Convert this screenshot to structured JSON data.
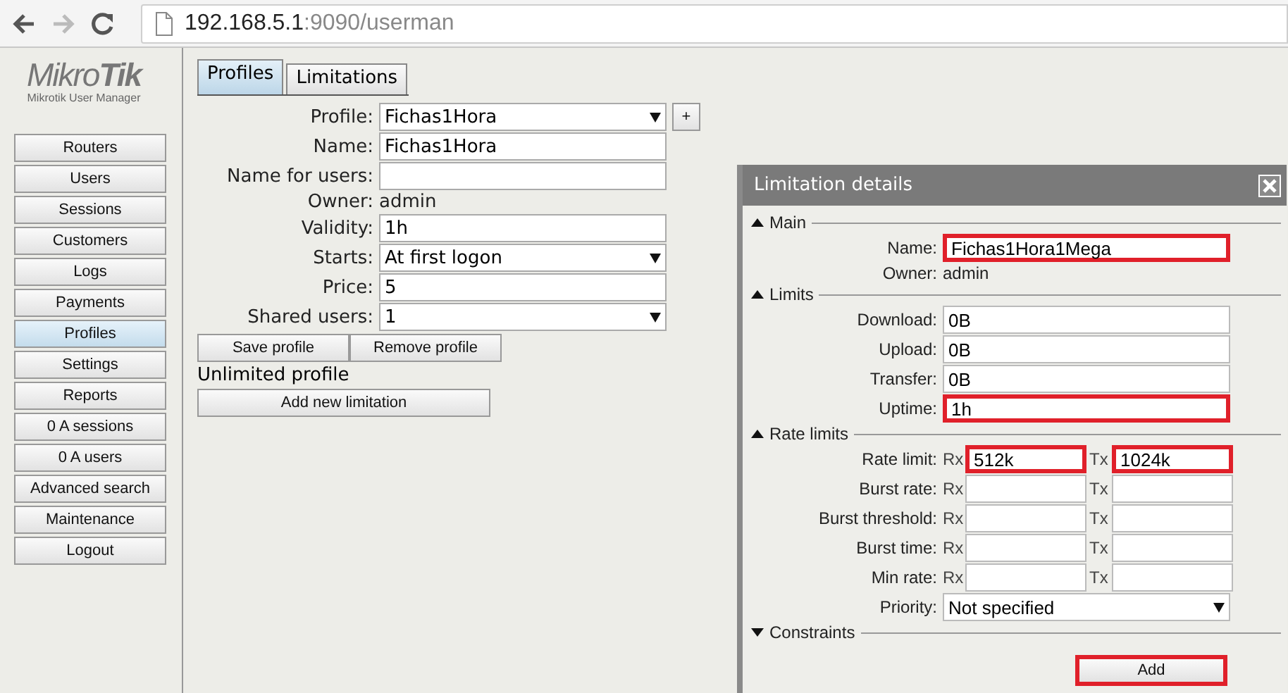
{
  "browser": {
    "url_host": "192.168.5.1",
    "url_rest": ":9090/userman"
  },
  "logo": {
    "brand_light": "Mikro",
    "brand_bold": "Tik",
    "subtitle": "Mikrotik User Manager"
  },
  "nav": [
    {
      "label": "Routers",
      "selected": false
    },
    {
      "label": "Users",
      "selected": false
    },
    {
      "label": "Sessions",
      "selected": false
    },
    {
      "label": "Customers",
      "selected": false
    },
    {
      "label": "Logs",
      "selected": false
    },
    {
      "label": "Payments",
      "selected": false
    },
    {
      "label": "Profiles",
      "selected": true
    },
    {
      "label": "Settings",
      "selected": false
    },
    {
      "label": "Reports",
      "selected": false
    },
    {
      "label": "0 A sessions",
      "selected": false
    },
    {
      "label": "0 A users",
      "selected": false
    },
    {
      "label": "Advanced search",
      "selected": false
    },
    {
      "label": "Maintenance",
      "selected": false
    },
    {
      "label": "Logout",
      "selected": false
    }
  ],
  "tabs": [
    {
      "label": "Profiles",
      "selected": true
    },
    {
      "label": "Limitations",
      "selected": false
    }
  ],
  "profile_form": {
    "fields": [
      {
        "kind": "select",
        "label": "Profile:",
        "value": "Fichas1Hora",
        "add_button": "+"
      },
      {
        "kind": "input",
        "label": "Name:",
        "value": "Fichas1Hora"
      },
      {
        "kind": "input",
        "label": "Name for users:"
      },
      {
        "kind": "text",
        "label": "Owner:",
        "value": "admin"
      },
      {
        "kind": "input",
        "label": "Validity:",
        "value": "1h"
      },
      {
        "kind": "select",
        "label": "Starts:",
        "value": "At first logon"
      },
      {
        "kind": "input",
        "label": "Price:",
        "value": "5"
      },
      {
        "kind": "select",
        "label": "Shared users:",
        "value": "1"
      }
    ],
    "buttons": [
      "Save profile",
      "Remove profile"
    ],
    "note": "Unlimited profile",
    "add_button": "Add new limitation"
  },
  "dialog": {
    "title": "Limitation details",
    "sections": [
      {
        "title": "Main",
        "expanded": true,
        "rows": [
          {
            "kind": "input",
            "label": "Name:",
            "value": "Fichas1Hora1Mega",
            "highlighted": true
          },
          {
            "kind": "text",
            "label": "Owner:",
            "value": "admin"
          }
        ]
      },
      {
        "title": "Limits",
        "expanded": true,
        "rows": [
          {
            "kind": "input",
            "label": "Download:",
            "value": "0B",
            "highlighted": false
          },
          {
            "kind": "input",
            "label": "Upload:",
            "value": "0B",
            "highlighted": false
          },
          {
            "kind": "input",
            "label": "Transfer:",
            "value": "0B",
            "highlighted": false
          },
          {
            "kind": "input",
            "label": "Uptime:",
            "value": "1h",
            "highlighted": true
          }
        ]
      },
      {
        "title": "Rate limits",
        "expanded": true,
        "rows": [
          {
            "kind": "pair",
            "label": "Rate limit:",
            "rx_label": "Rx",
            "rx_value": "512k",
            "rx_highlighted": true,
            "tx_label": "Tx",
            "tx_value": "1024k",
            "tx_highlighted": true
          },
          {
            "kind": "pair",
            "label": "Burst rate:",
            "rx_label": "Rx",
            "rx_highlighted": false,
            "tx_label": "Tx",
            "tx_highlighted": false
          },
          {
            "kind": "pair",
            "label": "Burst threshold:",
            "rx_label": "Rx",
            "rx_highlighted": false,
            "tx_label": "Tx",
            "tx_highlighted": false
          },
          {
            "kind": "pair",
            "label": "Burst time:",
            "rx_label": "Rx",
            "rx_highlighted": false,
            "tx_label": "Tx",
            "tx_highlighted": false
          },
          {
            "kind": "pair",
            "label": "Min rate:",
            "rx_label": "Rx",
            "rx_highlighted": false,
            "tx_label": "Tx",
            "tx_highlighted": false
          },
          {
            "kind": "select",
            "label": "Priority:",
            "value": "Not specified",
            "highlighted": false
          }
        ]
      },
      {
        "title": "Constraints",
        "expanded": false
      }
    ],
    "add_button": {
      "label": "Add",
      "highlighted": true
    }
  }
}
